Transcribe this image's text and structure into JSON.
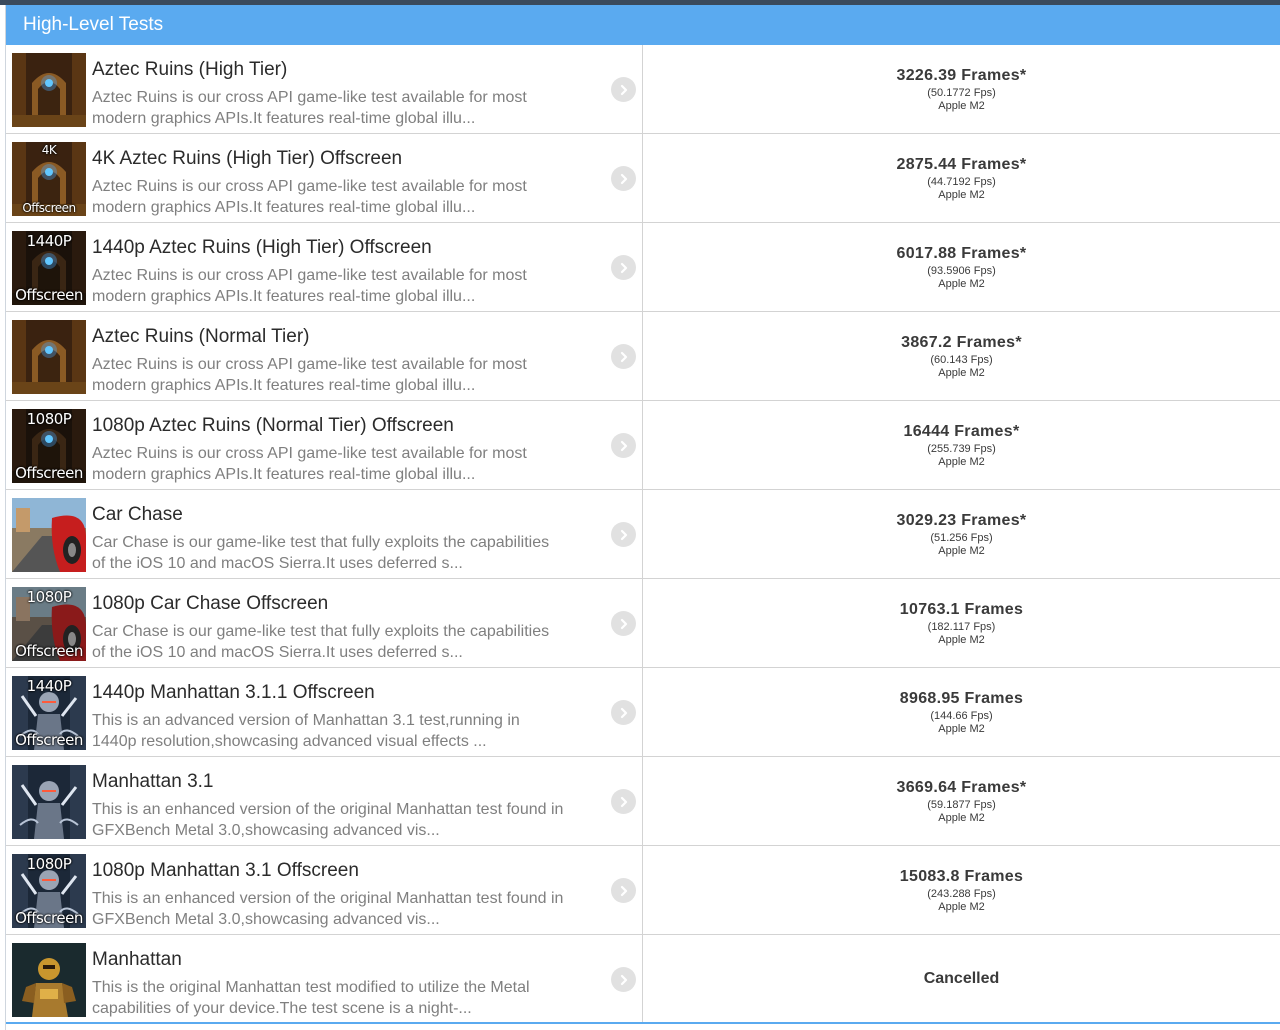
{
  "header": {
    "title": "High-Level Tests"
  },
  "tests": [
    {
      "title": "Aztec Ruins (High Tier)",
      "desc_line1": "Aztec Ruins is our cross API game-like test available for most",
      "desc_line2": "modern graphics APIs.It features real-time global illu...",
      "thumb_top": "",
      "thumb_bottom": "",
      "thumb_theme": "aztec",
      "score": "3226.39 Frames*",
      "fps": "(50.1772 Fps)",
      "device": "Apple M2"
    },
    {
      "title": "4K Aztec Ruins (High Tier) Offscreen",
      "desc_line1": "Aztec Ruins is our cross API game-like test available for most",
      "desc_line2": "modern graphics APIs.It features real-time global illu...",
      "thumb_top": "4K",
      "thumb_bottom": "Offscreen",
      "thumb_theme": "aztec",
      "thumb_small": true,
      "score": "2875.44 Frames*",
      "fps": "(44.7192 Fps)",
      "device": "Apple M2"
    },
    {
      "title": "1440p Aztec Ruins (High Tier) Offscreen",
      "desc_line1": "Aztec Ruins is our cross API game-like test available for most",
      "desc_line2": "modern graphics APIs.It features real-time global illu...",
      "thumb_top": "1440P",
      "thumb_bottom": "Offscreen",
      "thumb_theme": "aztec-dark",
      "score": "6017.88 Frames*",
      "fps": "(93.5906 Fps)",
      "device": "Apple M2"
    },
    {
      "title": "Aztec Ruins (Normal Tier)",
      "desc_line1": "Aztec Ruins is our cross API game-like test available for most",
      "desc_line2": "modern graphics APIs.It features real-time global illu...",
      "thumb_top": "",
      "thumb_bottom": "",
      "thumb_theme": "aztec",
      "score": "3867.2 Frames*",
      "fps": "(60.143 Fps)",
      "device": "Apple M2"
    },
    {
      "title": "1080p Aztec Ruins (Normal Tier) Offscreen",
      "desc_line1": "Aztec Ruins is our cross API game-like test available for most",
      "desc_line2": "modern graphics APIs.It features real-time global illu...",
      "thumb_top": "1080P",
      "thumb_bottom": "Offscreen",
      "thumb_theme": "aztec-dark",
      "score": "16444 Frames*",
      "fps": "(255.739 Fps)",
      "device": "Apple M2"
    },
    {
      "title": "Car Chase",
      "desc_line1": "Car Chase is our game-like test that fully exploits the capabilities",
      "desc_line2": "of the iOS 10 and macOS Sierra.It uses deferred s...",
      "thumb_top": "",
      "thumb_bottom": "",
      "thumb_theme": "car",
      "score": "3029.23 Frames*",
      "fps": "(51.256 Fps)",
      "device": "Apple M2"
    },
    {
      "title": "1080p Car Chase Offscreen",
      "desc_line1": "Car Chase is our game-like test that fully exploits the capabilities",
      "desc_line2": "of the iOS 10 and macOS Sierra.It uses deferred s...",
      "thumb_top": "1080P",
      "thumb_bottom": "Offscreen",
      "thumb_theme": "car-dim",
      "score": "10763.1 Frames",
      "fps": "(182.117 Fps)",
      "device": "Apple M2"
    },
    {
      "title": "1440p Manhattan 3.1.1 Offscreen",
      "desc_line1": "This is an advanced version of Manhattan 3.1 test,running in",
      "desc_line2": "1440p resolution,showcasing advanced visual effects ...",
      "thumb_top": "1440P",
      "thumb_bottom": "Offscreen",
      "thumb_theme": "manhattan",
      "score": "8968.95 Frames",
      "fps": "(144.66 Fps)",
      "device": "Apple M2"
    },
    {
      "title": "Manhattan 3.1",
      "desc_line1": "This is an enhanced version of the original Manhattan test found in",
      "desc_line2": "GFXBench Metal 3.0,showcasing advanced vis...",
      "thumb_top": "",
      "thumb_bottom": "",
      "thumb_theme": "manhattan",
      "score": "3669.64 Frames*",
      "fps": "(59.1877 Fps)",
      "device": "Apple M2"
    },
    {
      "title": "1080p Manhattan 3.1 Offscreen",
      "desc_line1": "This is an enhanced version of the original Manhattan test found in",
      "desc_line2": "GFXBench Metal 3.0,showcasing advanced vis...",
      "thumb_top": "1080P",
      "thumb_bottom": "Offscreen",
      "thumb_theme": "manhattan",
      "score": "15083.8 Frames",
      "fps": "(243.288 Fps)",
      "device": "Apple M2"
    },
    {
      "title": "Manhattan",
      "desc_line1": "This is the original Manhattan test modified to utilize the Metal",
      "desc_line2": "capabilities of your device.The test scene is a night-...",
      "thumb_top": "",
      "thumb_bottom": "",
      "thumb_theme": "robot",
      "score": "",
      "fps": "",
      "device": "",
      "status": "Cancelled"
    }
  ],
  "icons": {
    "row_chevron": "chevron-right-icon"
  },
  "colors": {
    "header_bg": "#5aaaf0",
    "chevron_bg": "#e1e1e1"
  }
}
